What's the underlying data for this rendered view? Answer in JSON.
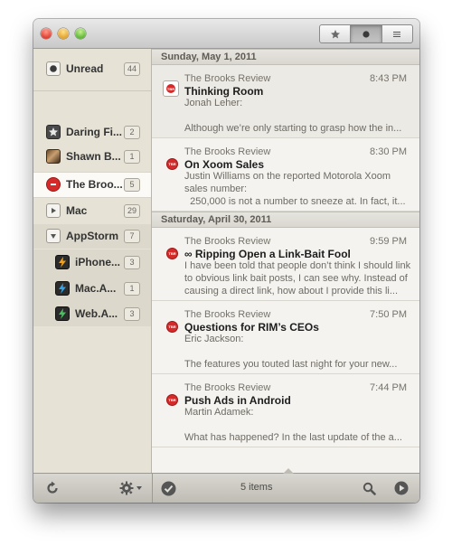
{
  "toolbar": {
    "segments": [
      {
        "name": "star-icon",
        "glyph": "★",
        "active": false
      },
      {
        "name": "dot-icon",
        "glyph": "●",
        "active": true
      },
      {
        "name": "list-icon",
        "glyph": "≡",
        "active": false
      }
    ]
  },
  "sidebar": {
    "items": [
      {
        "label": "Unread",
        "count": "44"
      },
      {
        "label": "Daring Fi...",
        "count": "2"
      },
      {
        "label": "Shawn B...",
        "count": "1"
      },
      {
        "label": "The Broo...",
        "count": "5"
      },
      {
        "label": "Mac",
        "count": "29"
      },
      {
        "label": "AppStorm",
        "count": "7"
      },
      {
        "label": "iPhone...",
        "count": "3"
      },
      {
        "label": "Mac.A...",
        "count": "1"
      },
      {
        "label": "Web.A...",
        "count": "3"
      }
    ]
  },
  "groups": [
    {
      "date": "Sunday, May 1, 2011",
      "articles": [
        {
          "source": "The Brooks Review",
          "time": "8:43 PM",
          "title": "Thinking Room",
          "lines": [
            "Jonah Leher:",
            "",
            "Although we’re only starting to grasp how the in..."
          ]
        },
        {
          "source": "The Brooks Review",
          "time": "8:30 PM",
          "title": "On Xoom Sales",
          "lines": [
            "Justin Williams on the reported Motorola Xoom",
            "sales number:",
            "  250,000 is not a number to sneeze at. In fact, it..."
          ]
        }
      ]
    },
    {
      "date": "Saturday, April 30, 2011",
      "articles": [
        {
          "source": "The Brooks Review",
          "time": "9:59 PM",
          "title": "∞ Ripping Open a Link-Bait Fool",
          "lines": [
            "I have been told that people don’t think I should link",
            "to obvious link bait posts, I can see why. Instead of",
            "causing a direct link, how about I provide this li..."
          ]
        },
        {
          "source": "The Brooks Review",
          "time": "7:50 PM",
          "title": "Questions for RIM’s CEOs",
          "lines": [
            "Eric Jackson:",
            "",
            "The features you touted last night for your new..."
          ]
        },
        {
          "source": "The Brooks Review",
          "time": "7:44 PM",
          "title": "Push Ads in Android",
          "lines": [
            "Martin Adamek:",
            "",
            "What has happened? In the last update of the a..."
          ]
        }
      ]
    }
  ],
  "bottom": {
    "count_label": "5 items"
  },
  "colors": {
    "accent_red": "#d42a2a",
    "sidebar_bg": "#e6e2d6"
  }
}
